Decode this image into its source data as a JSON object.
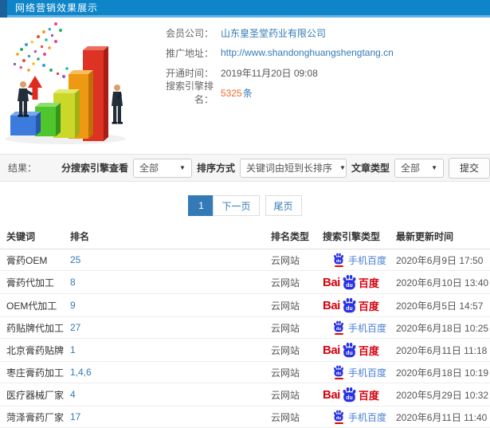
{
  "header": {
    "title": "网络营销效果展示"
  },
  "info": {
    "member": {
      "label": "会员公司：",
      "value": "山东皇圣堂药业有限公司"
    },
    "site": {
      "label": "推广地址：",
      "value": "http://www.shandonghuangshengtang.cn"
    },
    "opened": {
      "label": "开通时间：",
      "value": "2019年11月20日 09:08"
    },
    "rank_count": {
      "label": "搜索引擎排名：",
      "count": "5325",
      "unit": "条"
    }
  },
  "filters": {
    "result_label": "结果：",
    "engine_view": {
      "label": "分搜索引擎查看",
      "selected": "全部"
    },
    "sort": {
      "label": "排序方式",
      "selected": "关键词由短到长排序"
    },
    "article_type": {
      "label": "文章类型",
      "selected": "全部"
    },
    "submit_label": "提交"
  },
  "pagination": {
    "current": "1",
    "next_label": "下一页",
    "last_label": "尾页"
  },
  "table": {
    "columns": [
      "关键词",
      "排名",
      "排名类型",
      "搜索引擎类型",
      "最新更新时间"
    ],
    "engine_labels": {
      "baidu": {
        "prefix": "Bai",
        "pad": "du",
        "suffix": "百度"
      },
      "mobile": {
        "pad": "du",
        "label": "手机百度"
      }
    },
    "rows": [
      {
        "keyword": "膏药OEM",
        "rank": "25",
        "rank_type": "云网站",
        "engine": "mobile",
        "updated": "2020年6月9日 17:50"
      },
      {
        "keyword": "膏药代加工",
        "rank": "8",
        "rank_type": "云网站",
        "engine": "baidu",
        "updated": "2020年6月10日 13:40"
      },
      {
        "keyword": "OEM代加工",
        "rank": "9",
        "rank_type": "云网站",
        "engine": "baidu",
        "updated": "2020年6月5日 14:57"
      },
      {
        "keyword": "药贴牌代加工",
        "rank": "27",
        "rank_type": "云网站",
        "engine": "mobile",
        "updated": "2020年6月18日 10:25"
      },
      {
        "keyword": "北京膏药贴牌",
        "rank": "1",
        "rank_type": "云网站",
        "engine": "baidu",
        "updated": "2020年6月11日 11:18"
      },
      {
        "keyword": "枣庄膏药加工",
        "rank": "1,4,6",
        "rank_type": "云网站",
        "engine": "mobile",
        "updated": "2020年6月18日 10:19"
      },
      {
        "keyword": "医疗器械厂家",
        "rank": "4",
        "rank_type": "云网站",
        "engine": "baidu",
        "updated": "2020年5月29日 10:32"
      },
      {
        "keyword": "菏泽膏药厂家",
        "rank": "17",
        "rank_type": "云网站",
        "engine": "mobile",
        "updated": "2020年6月11日 11:40"
      }
    ]
  },
  "colors": {
    "header_blue": "#0d85c8",
    "header_dark_strip": "#1c619b",
    "header_light_border": "#66b1de",
    "link_blue": "#337ab7",
    "count_orange": "#f4682c",
    "baidu_red": "#d6020e",
    "baidu_blue": "#2932e1",
    "mobile_text_blue": "#4a7fd0",
    "filter_bar_bg": "#f6f6f6"
  }
}
